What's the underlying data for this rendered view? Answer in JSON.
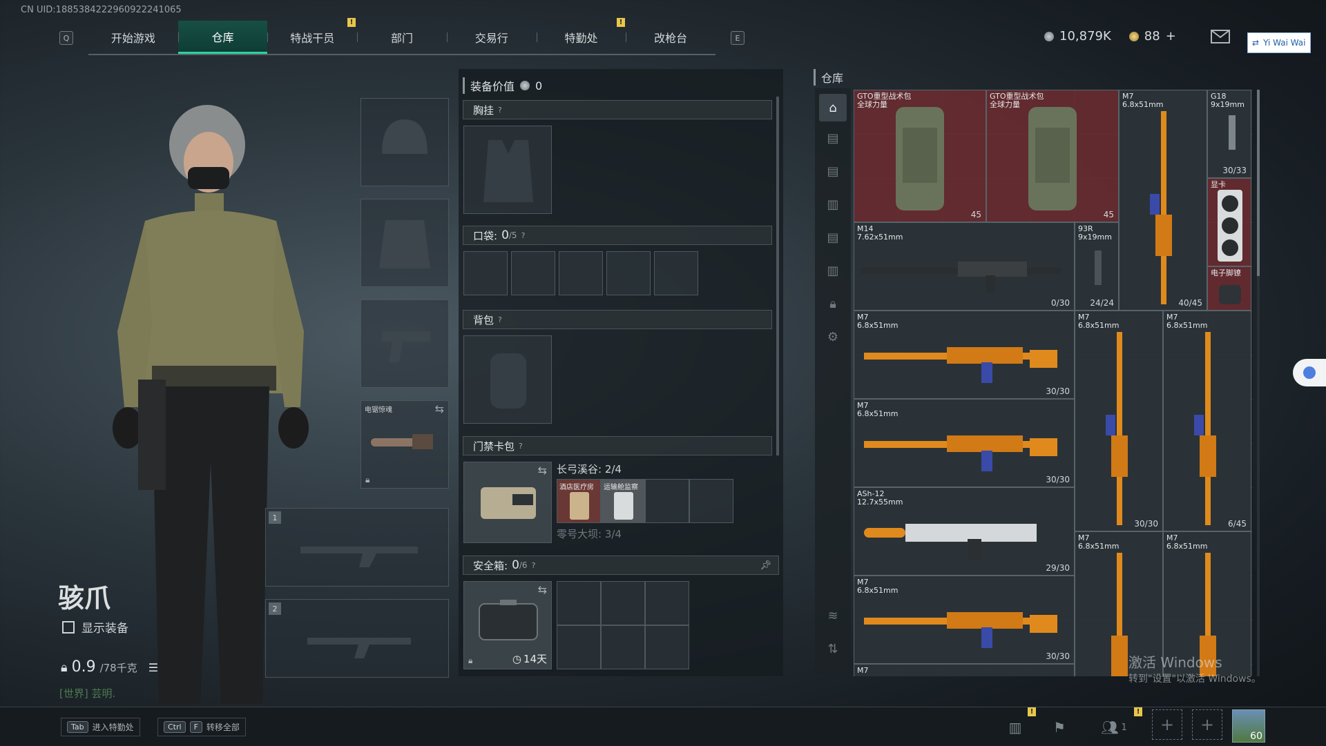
{
  "uid": "CN UID:1885384222960922241065",
  "nav": {
    "key_left": "Q",
    "key_right": "E",
    "tabs": [
      "开始游戏",
      "仓库",
      "特战干员",
      "部门",
      "交易行",
      "特勤处",
      "改枪台"
    ],
    "active_index": 1,
    "alert_mark": "!"
  },
  "currency": {
    "silver": "10,879K",
    "gold": "88",
    "gold_add": "+"
  },
  "user_badge": "Yi Wai Wai",
  "operator": {
    "name": "骇爪",
    "show_equipment_label": "显示装备",
    "weight_value": "0.9",
    "weight_max": "/78千克",
    "world_msg": "[世界] 芸明."
  },
  "equip_column": {
    "melee_label": "电锯惊魂",
    "weapon_slot_1": "1",
    "weapon_slot_2": "2"
  },
  "middle": {
    "value_label": "装备价值",
    "value": "0",
    "chest_label": "胸挂",
    "pocket_label": "口袋:",
    "pocket_count": "0",
    "pocket_max": "/5",
    "backpack_label": "背包",
    "keycard_label": "门禁卡包",
    "keycard_line1": "长弓溪谷: 2/4",
    "keycard_line2": "零号大坝: 3/4",
    "card_1": "酒店医疗房",
    "card_2": "运输舱监察",
    "safebox_label": "安全箱:",
    "safebox_count": "0",
    "safebox_max": "/6",
    "safebox_timer": "14天",
    "help": "?"
  },
  "warehouse": {
    "title": "仓库",
    "items": [
      {
        "name": "GTO重型战术包\n全球力量",
        "count": "45"
      },
      {
        "name": "GTO重型战术包\n全球力量",
        "count": "45"
      },
      {
        "name": "M7\n6.8x51mm",
        "count": "40/45"
      },
      {
        "name": "G18\n9x19mm",
        "count": "30/33"
      },
      {
        "name": "显卡",
        "count": ""
      },
      {
        "name": "电子脚镣",
        "count": ""
      },
      {
        "name": "M14\n7.62x51mm",
        "count": "0/30"
      },
      {
        "name": "93R\n9x19mm",
        "count": "24/24"
      },
      {
        "name": "M7\n6.8x51mm",
        "count": "30/30"
      },
      {
        "name": "M7\n6.8x51mm",
        "count": "30/30"
      },
      {
        "name": "M7\n6.8x51mm",
        "count": "6/45"
      },
      {
        "name": "M7\n6.8x51mm",
        "count": "30/30"
      },
      {
        "name": "ASh-12\n12.7x55mm",
        "count": "29/30"
      },
      {
        "name": "M7\n6.8x51mm",
        "count": ""
      },
      {
        "name": "M7\n6.8x51mm",
        "count": ""
      },
      {
        "name": "M7\n6.8x51mm",
        "count": "30/30"
      },
      {
        "name": "M7",
        "count": ""
      }
    ]
  },
  "bottom": {
    "hint1_key": "Tab",
    "hint1_text": "进入特勤处",
    "hint2_key1": "Ctrl",
    "hint2_key2": "F",
    "hint2_text": "转移全部",
    "friends_count": "1",
    "level": "60"
  },
  "watermark": {
    "line1": "激活 Windows",
    "line2": "转到\"设置\"以激活 Windows。"
  },
  "colors": {
    "accent": "#2fd3a0",
    "item_red": "#6e2e32",
    "gun_orange": "#e08a1e"
  }
}
